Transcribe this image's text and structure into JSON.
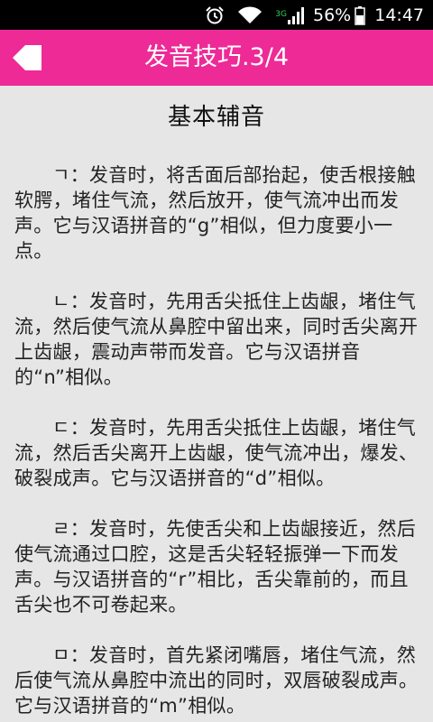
{
  "status_bar": {
    "network_type": "3G",
    "battery_percent": "56%",
    "time": "14:47"
  },
  "action_bar": {
    "title": "发音技巧.3/4",
    "background_color": "#ee2a97"
  },
  "content": {
    "heading": "基本辅音",
    "paragraphs": [
      "ㄱ：发音时，将舌面后部抬起，使舌根接触软腭，堵住气流，然后放开，使气流冲出而发声。它与汉语拼音的“g”相似，但力度要小一点。",
      "ㄴ：发音时，先用舌尖抵住上齿龈，堵住气流，然后使气流从鼻腔中留出来，同时舌尖离开上齿龈，震动声带而发音。它与汉语拼音的“n”相似。",
      "ㄷ：发音时，先用舌尖抵住上齿龈，堵住气流，然后舌尖离开上齿龈，使气流冲出，爆发、破裂成声。它与汉语拼音的“d”相似。",
      "ㄹ：发音时，先使舌尖和上齿龈接近，然后使气流通过口腔，这是舌尖轻轻振弹一下而发声。与汉语拼音的“r”相比，舌尖靠前的，而且舌尖也不可卷起来。",
      "ㅁ：发音时，首先紧闭嘴唇，堵住气流，然后使气流从鼻腔中流出的同时，双唇破裂成声。它与汉语拼音的“m”相似。"
    ]
  }
}
